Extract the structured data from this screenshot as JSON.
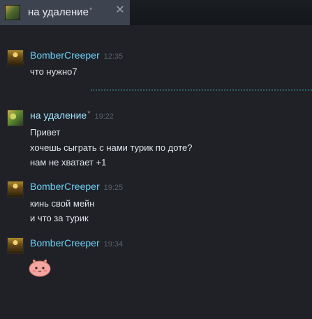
{
  "tab": {
    "title": "на удаление",
    "unread_mark": "*",
    "close_label": "✕"
  },
  "messages": [
    {
      "sender": "BomberCreeper",
      "time": "12:35",
      "lines": [
        "что нужно7"
      ]
    },
    {
      "sender": "на удаление",
      "sender_mark": "*",
      "time": "19:22",
      "lines": [
        "Привет",
        "хочешь сыграть с нами турик по доте?",
        "нам не хватает +1"
      ]
    },
    {
      "sender": "BomberCreeper",
      "time": "19:25",
      "lines": [
        "кинь свой мейн",
        "и что за турик"
      ]
    },
    {
      "sender": "BomberCreeper",
      "time": "19:34",
      "sticker": "pink-blob-sticker"
    }
  ],
  "colors": {
    "background": "#1f2126",
    "tab_active": "#3d4450",
    "sender_name": "#6dcff6",
    "divider": "#2f5f63"
  }
}
